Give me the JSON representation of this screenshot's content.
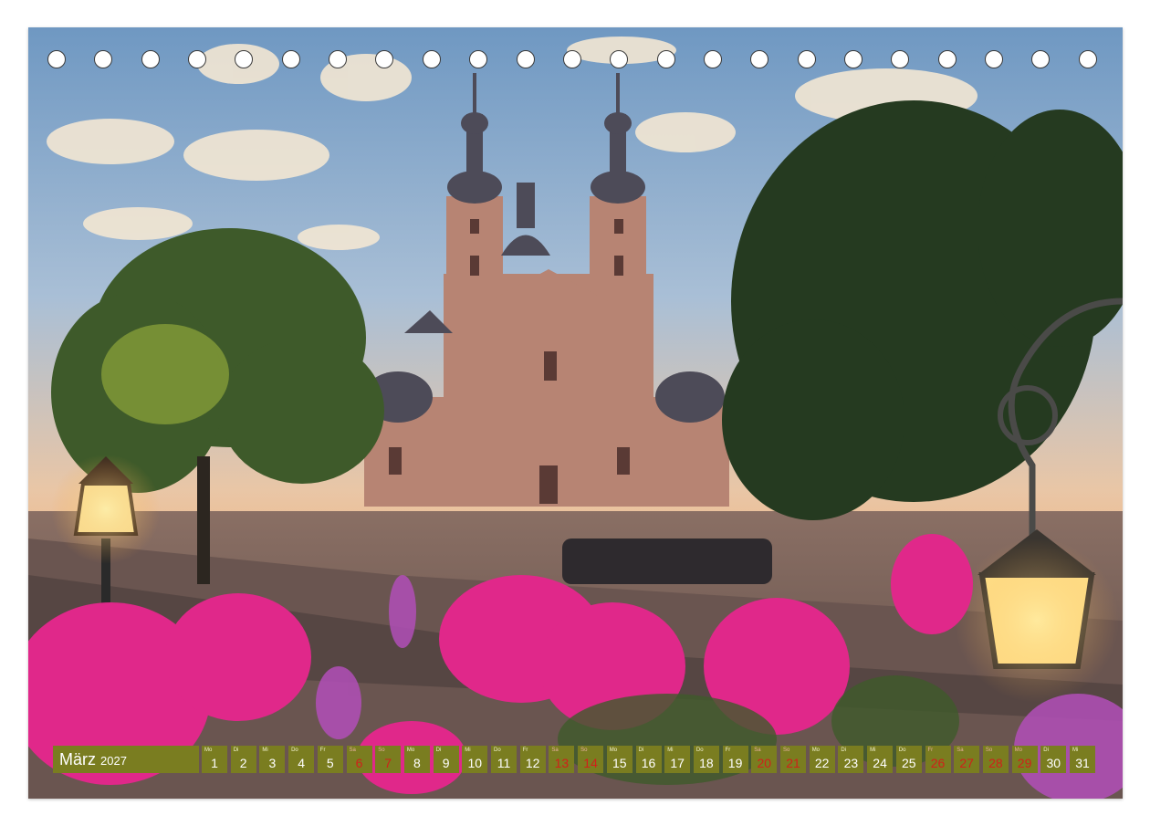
{
  "calendar": {
    "month": "März",
    "year": "2027",
    "days": [
      {
        "wd": "Mo",
        "num": "1",
        "weekend": false
      },
      {
        "wd": "Di",
        "num": "2",
        "weekend": false
      },
      {
        "wd": "Mi",
        "num": "3",
        "weekend": false
      },
      {
        "wd": "Do",
        "num": "4",
        "weekend": false
      },
      {
        "wd": "Fr",
        "num": "5",
        "weekend": false
      },
      {
        "wd": "Sa",
        "num": "6",
        "weekend": true
      },
      {
        "wd": "So",
        "num": "7",
        "weekend": true
      },
      {
        "wd": "Mo",
        "num": "8",
        "weekend": false
      },
      {
        "wd": "Di",
        "num": "9",
        "weekend": false
      },
      {
        "wd": "Mi",
        "num": "10",
        "weekend": false
      },
      {
        "wd": "Do",
        "num": "11",
        "weekend": false
      },
      {
        "wd": "Fr",
        "num": "12",
        "weekend": false
      },
      {
        "wd": "Sa",
        "num": "13",
        "weekend": true
      },
      {
        "wd": "So",
        "num": "14",
        "weekend": true
      },
      {
        "wd": "Mo",
        "num": "15",
        "weekend": false
      },
      {
        "wd": "Di",
        "num": "16",
        "weekend": false
      },
      {
        "wd": "Mi",
        "num": "17",
        "weekend": false
      },
      {
        "wd": "Do",
        "num": "18",
        "weekend": false
      },
      {
        "wd": "Fr",
        "num": "19",
        "weekend": false
      },
      {
        "wd": "Sa",
        "num": "20",
        "weekend": true
      },
      {
        "wd": "So",
        "num": "21",
        "weekend": true
      },
      {
        "wd": "Mo",
        "num": "22",
        "weekend": false
      },
      {
        "wd": "Di",
        "num": "23",
        "weekend": false
      },
      {
        "wd": "Mi",
        "num": "24",
        "weekend": false
      },
      {
        "wd": "Do",
        "num": "25",
        "weekend": false
      },
      {
        "wd": "Fr",
        "num": "26",
        "weekend": true
      },
      {
        "wd": "Sa",
        "num": "27",
        "weekend": true
      },
      {
        "wd": "So",
        "num": "28",
        "weekend": true
      },
      {
        "wd": "Mo",
        "num": "29",
        "weekend": true
      },
      {
        "wd": "Di",
        "num": "30",
        "weekend": false
      },
      {
        "wd": "Mi",
        "num": "31",
        "weekend": false
      }
    ]
  },
  "colors": {
    "bar": "#7a7d20",
    "weekend_text": "#d0201a",
    "sky_top": "#7fa6c9",
    "sky_bottom": "#f1c49a",
    "cathedral": "#b98a7a",
    "foliage": "#2f4a25",
    "flowers": "#e0288a"
  },
  "binding_holes": 23
}
